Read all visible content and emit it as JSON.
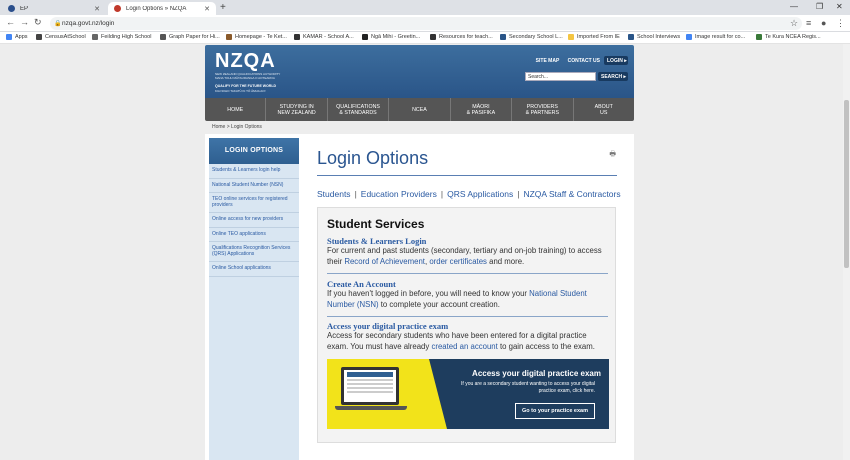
{
  "browser": {
    "tabs": [
      {
        "title": "EP",
        "active": false
      },
      {
        "title": "Login Options » NZQA",
        "active": true
      }
    ],
    "url": "nzqa.govt.nz/login",
    "bookmarks": [
      "Apps",
      "CensusAtSchool",
      "Feilding High School",
      "Graph Paper for Hi...",
      "Homepage - Te Ket...",
      "KAMAR - School A...",
      "Ngā Mihi - Greetin...",
      "Resources for teach...",
      "Secondary School L...",
      "Imported From IE",
      "School Interviews",
      "Image result for co...",
      "Te Kura NCEA Regis..."
    ]
  },
  "header": {
    "logo": "NZQA",
    "logo_sub": "NEW ZEALAND QUALIFICATIONS AUTHORITY MANA TOHU MĀTAURANGA O AOTEAROA",
    "tagline": "QUALIFY FOR THE FUTURE WORLD",
    "tagline_maori": "KIA NOHO TAKATŪ KI TŌ ĀMUA AO!",
    "site_map": "SITE MAP",
    "contact_us": "CONTACT US",
    "login": "LOGIN",
    "search_value": "Search...",
    "search_button": "SEARCH"
  },
  "nav": [
    "HOME",
    "STUDYING IN\nNEW ZEALAND",
    "QUALIFICATIONS\n& STANDARDS",
    "NCEA",
    "MĀORI\n& PASIFIKA",
    "PROVIDERS\n& PARTNERS",
    "ABOUT\nUS"
  ],
  "breadcrumb": "Home > Login Options",
  "sidebar": {
    "heading": "LOGIN OPTIONS",
    "items": [
      "Students & Learners login help",
      "National Student Number (NSN)",
      "TEO online services for registered providers",
      "Online access for new providers",
      "Online TEO applications",
      "Qualifications Recognition Services (QRS) Applications",
      "Online School applications"
    ]
  },
  "main": {
    "title": "Login Options",
    "links": [
      "Students",
      "Education Providers",
      "QRS Applications",
      "NZQA Staff & Contractors"
    ],
    "box_title": "Student Services",
    "sections": [
      {
        "heading": "Students & Learners Login",
        "t1": "For current and past students (secondary, tertiary and on-job training) to access their ",
        "l1": "Record of Achievement",
        "t2": ", ",
        "l2": "order certificates",
        "t3": " and more."
      },
      {
        "heading": "Create An Account",
        "t1": "If you haven't logged in before, you will need to know your ",
        "l1": "National Student Number (NSN)",
        "t2": " to complete your account creation."
      },
      {
        "heading": "Access your digital practice exam",
        "t1": "Access for secondary students who have been entered for a digital practice exam. You must have already ",
        "l1": "created an account",
        "t2": " to gain access to the exam."
      }
    ],
    "banner": {
      "title": "Access your digital practice exam",
      "subtitle": "If you are a secondary student wanting to access your digital practice exam, click here.",
      "button": "Go to your practice exam"
    }
  }
}
